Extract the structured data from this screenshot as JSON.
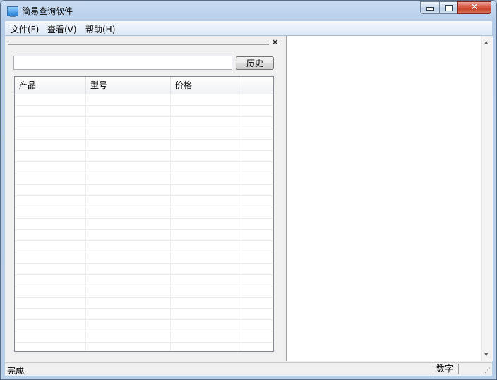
{
  "window": {
    "title": "简易查询软件"
  },
  "menu": [
    {
      "label": "文件(F)"
    },
    {
      "label": "查看(V)"
    },
    {
      "label": "帮助(H)"
    }
  ],
  "pane": {
    "close_glyph": "×"
  },
  "search": {
    "value": "",
    "placeholder": "",
    "button_label": "历史"
  },
  "table": {
    "columns": [
      {
        "label": "产品"
      },
      {
        "label": "型号"
      },
      {
        "label": "价格"
      },
      {
        "label": ""
      }
    ],
    "rows": []
  },
  "status": {
    "text": "完成",
    "indicator": "数字"
  },
  "icons": {
    "app": "computer-monitor-icon",
    "minimize": "minimize-icon",
    "maximize": "restore-icon",
    "close": "close-icon",
    "pane_close": "close-icon",
    "scroll_up": "chevron-up-icon",
    "scroll_down": "chevron-down-icon",
    "size_grip": "resize-grip-icon"
  },
  "colors": {
    "titlebar": "#b8cfe9",
    "close_button": "#c8452d",
    "client": "#f0f0f0"
  }
}
